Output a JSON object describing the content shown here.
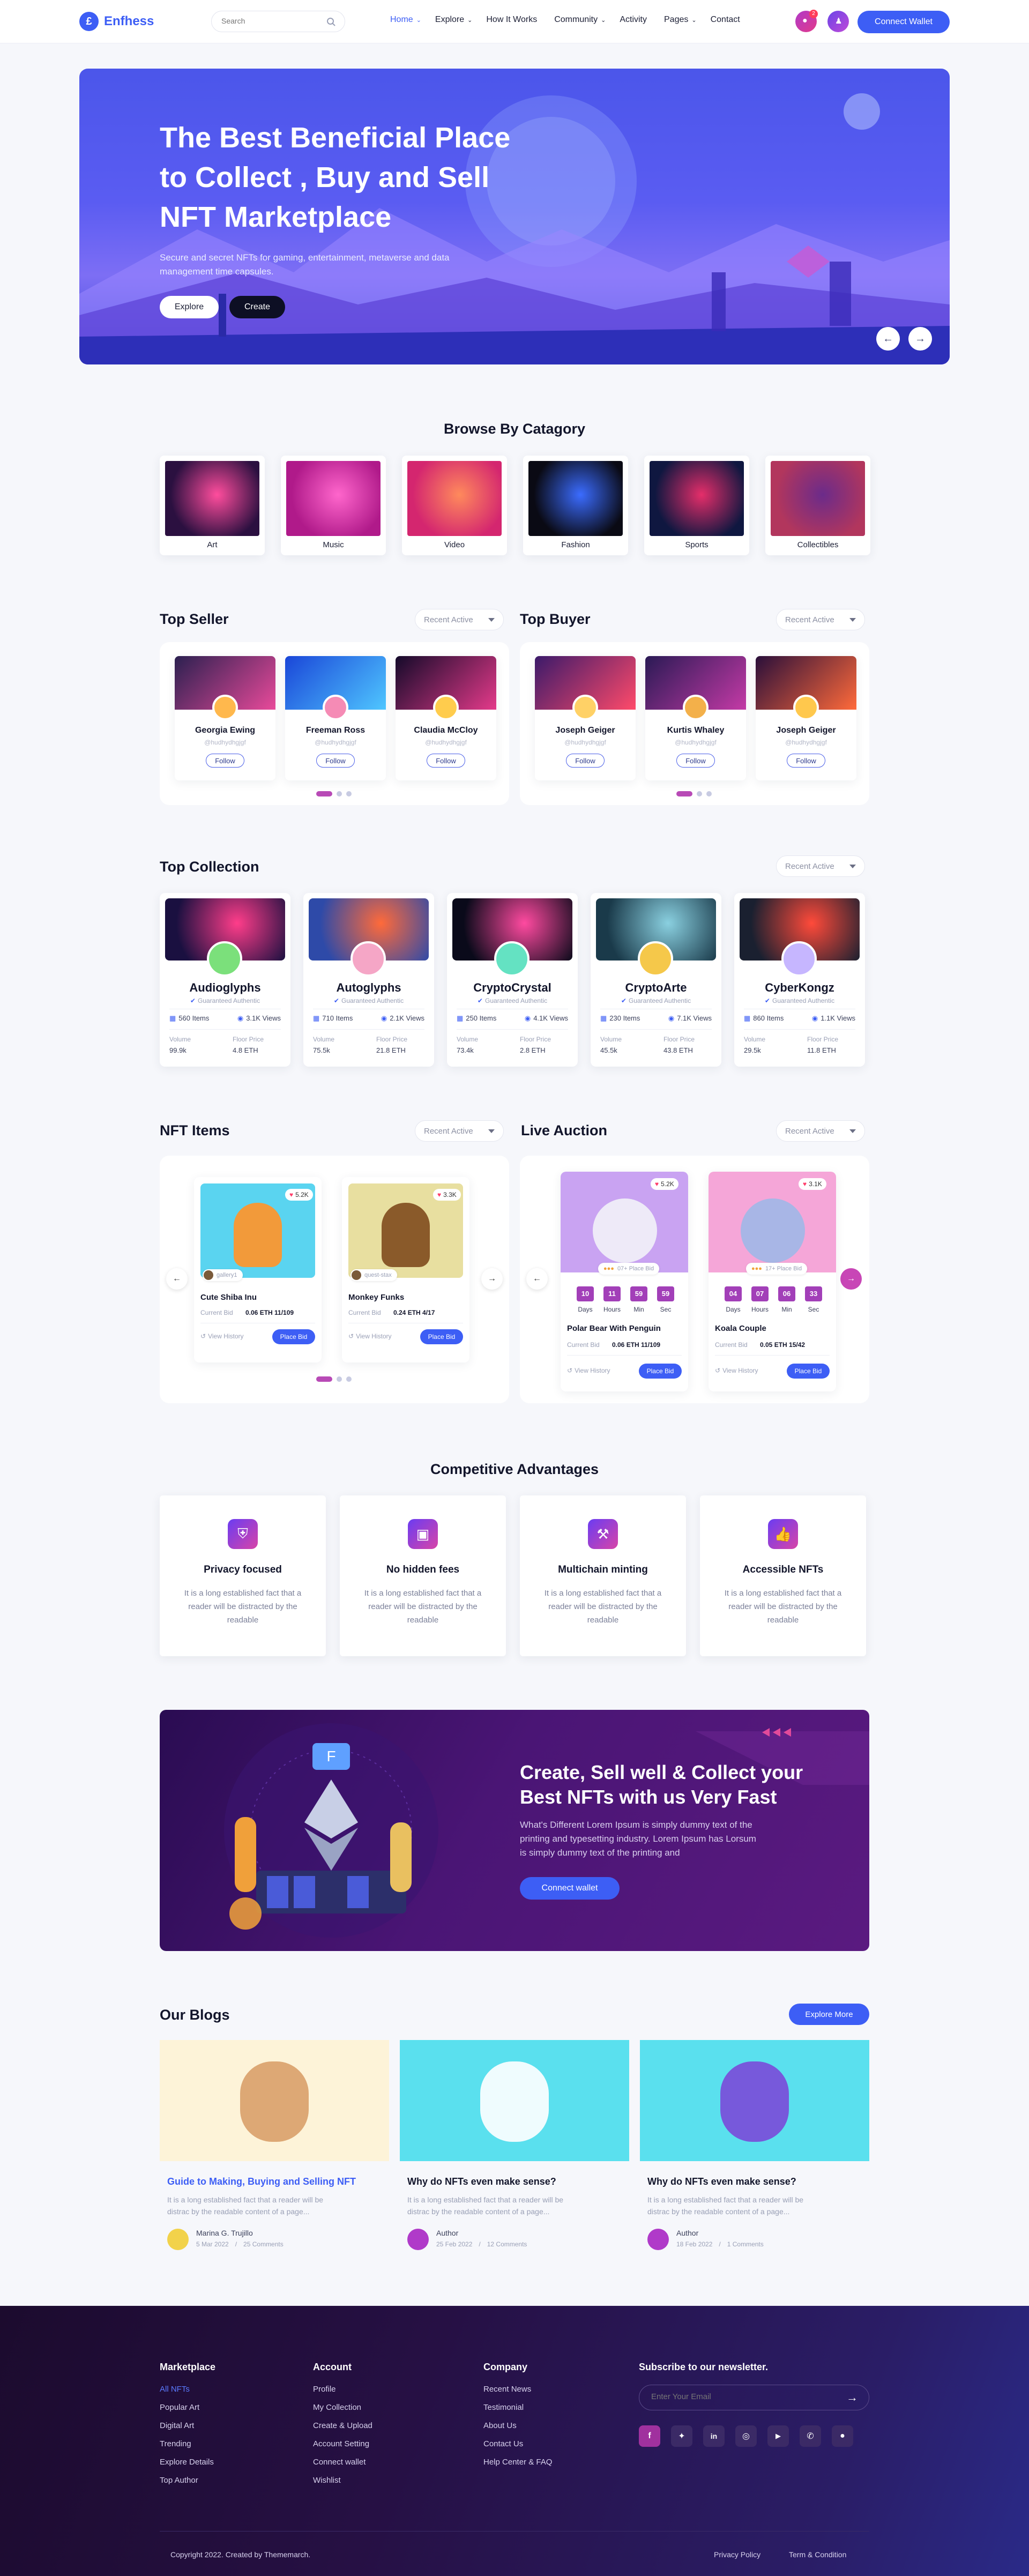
{
  "nav": {
    "logo": "Enfhess",
    "search_placeholder": "Search",
    "links": [
      "Home",
      "Explore",
      "How It Works",
      "Community",
      "Activity",
      "Pages",
      "Contact"
    ],
    "connect": "Connect Wallet",
    "notif_count": "2"
  },
  "hero": {
    "title_l1": "The Best Beneficial Place",
    "title_l2": "to Collect , Buy and Sell",
    "title_l3": "NFT Marketplace",
    "sub_l1": "Secure and secret NFTs for gaming, entertainment, metaverse and data",
    "sub_l2": "management time capsules.",
    "btn_explore": "Explore",
    "btn_create": "Create"
  },
  "browse": {
    "title": "Browse By Catagory",
    "items": [
      {
        "label": "Art",
        "c1": "#2b1040",
        "c2": "#ff4d9d"
      },
      {
        "label": "Music",
        "c1": "#b01a8a",
        "c2": "#ff66cc"
      },
      {
        "label": "Video",
        "c1": "#d4266f",
        "c2": "#ff8a5c"
      },
      {
        "label": "Fashion",
        "c1": "#0a0a14",
        "c2": "#3b6cff"
      },
      {
        "label": "Sports",
        "c1": "#0f1740",
        "c2": "#e52e6a"
      },
      {
        "label": "Collectibles",
        "c1": "#b2365d",
        "c2": "#6b2b8a"
      }
    ]
  },
  "seller": {
    "title": "Top Seller",
    "dd": "Recent Active",
    "cards": [
      {
        "name": "Georgia Ewing",
        "handle": "@hudhydhgjgf"
      },
      {
        "name": "Freeman Ross",
        "handle": "@hudhydhgjgf"
      },
      {
        "name": "Claudia McCloy",
        "handle": "@hudhydhgjgf"
      }
    ],
    "follow": "Follow"
  },
  "buyer": {
    "title": "Top Buyer",
    "dd": "Recent Active",
    "cards": [
      {
        "name": "Joseph Geiger",
        "handle": "@hudhydhgjgf"
      },
      {
        "name": "Kurtis Whaley",
        "handle": "@hudhydhgjgf"
      },
      {
        "name": "Joseph Geiger",
        "handle": "@hudhydhgjgf"
      }
    ],
    "follow": "Follow"
  },
  "collection": {
    "title": "Top Collection",
    "dd": "Recent Active",
    "vol_label": "Volume",
    "floor_label": "Floor Price",
    "guaranteed": "Guaranteed Authentic",
    "cards": [
      {
        "name": "Audioglyphs",
        "items": "560 Items",
        "views": "3.1K Views",
        "vol": "99.9k",
        "floor": "4.8 ETH"
      },
      {
        "name": "Autoglyphs",
        "items": "710 Items",
        "views": "2.1K Views",
        "vol": "75.5k",
        "floor": "21.8 ETH"
      },
      {
        "name": "CryptoCrystal",
        "items": "250 Items",
        "views": "4.1K Views",
        "vol": "73.4k",
        "floor": "2.8 ETH"
      },
      {
        "name": "CryptoArte",
        "items": "230 Items",
        "views": "7.1K Views",
        "vol": "45.5k",
        "floor": "43.8 ETH"
      },
      {
        "name": "CyberKongz",
        "items": "860 Items",
        "views": "1.1K Views",
        "vol": "29.5k",
        "floor": "11.8 ETH"
      }
    ]
  },
  "nft": {
    "title": "NFT Items",
    "dd": "Recent Active",
    "cur_label": "Current Bid",
    "history": "View History",
    "place": "Place Bid",
    "cards": [
      {
        "name": "Cute Shiba Inu",
        "likes": "5.2K",
        "user": "gallery1",
        "bid": "0.06 ETH 11/109"
      },
      {
        "name": "Monkey Funks",
        "likes": "3.3K",
        "user": "quest-stax",
        "bid": "0.24 ETH 4/17"
      }
    ]
  },
  "auction": {
    "title": "Live Auction",
    "dd": "Recent Active",
    "cur_label": "Current Bid",
    "history": "View History",
    "place": "Place Bid",
    "units": [
      "Days",
      "Hours",
      "Min",
      "Sec"
    ],
    "cards": [
      {
        "name": "Polar Bear With Penguin",
        "likes": "5.2K",
        "bids": "07+ Place Bid",
        "cd": [
          "10",
          "11",
          "59",
          "59"
        ],
        "bid": "0.06 ETH 11/109"
      },
      {
        "name": "Koala Couple",
        "likes": "3.1K",
        "bids": "17+ Place Bid",
        "cd": [
          "04",
          "07",
          "06",
          "33"
        ],
        "bid": "0.05 ETH 15/42"
      }
    ]
  },
  "adv": {
    "title": "Competitive Advantages",
    "body": "It is a long established fact that a reader will be distracted by the readable",
    "items": [
      {
        "title": "Privacy focused"
      },
      {
        "title": "No hidden fees"
      },
      {
        "title": "Multichain minting"
      },
      {
        "title": "Accessible NFTs"
      }
    ]
  },
  "cta": {
    "title_l1": "Create, Sell well & Collect your",
    "title_l2": "Best NFTs with us Very Fast",
    "body_l1": "What's Different Lorem Ipsum is simply dummy text of the",
    "body_l2": "printing and typesetting industry. Lorem Ipsum has Lorsum",
    "body_l3": "is simply dummy text of the printing and",
    "btn": "Connect wallet"
  },
  "blogs": {
    "title": "Our Blogs",
    "explore": "Explore More",
    "excerpt_l1": "It is a long established fact that a reader will be",
    "excerpt_l2": "distrac by the readable content of a page...",
    "items": [
      {
        "title": "Guide to Making, Buying and Selling NFT",
        "author": "Marina G. Trujillo",
        "date": "5 Mar 2022",
        "comments": "25 Comments"
      },
      {
        "title": "Why do NFTs even make sense?",
        "author": "Author",
        "date": "25 Feb 2022",
        "comments": "12 Comments"
      },
      {
        "title": "Why do NFTs even make sense?",
        "author": "Author",
        "date": "18 Feb 2022",
        "comments": "1 Comments"
      }
    ]
  },
  "footer": {
    "marketplace": {
      "title": "Marketplace",
      "links": [
        "All NFTs",
        "Popular Art",
        "Digital Art",
        "Trending",
        "Explore Details",
        "Top Author"
      ]
    },
    "account": {
      "title": "Account",
      "links": [
        "Profile",
        "My Collection",
        "Create & Upload",
        "Account Setting",
        "Connect wallet",
        "Wishlist"
      ]
    },
    "company": {
      "title": "Company",
      "links": [
        "Recent News",
        "Testimonial",
        "About Us",
        "Contact Us",
        "Help Center & FAQ"
      ]
    },
    "newsletter": {
      "title": "Subscribe to our newsletter.",
      "placeholder": "Enter Your Email"
    },
    "copyright": "Copyright 2022. Created by Thememarch.",
    "privacy": "Privacy Policy",
    "terms": "Term & Condition"
  }
}
